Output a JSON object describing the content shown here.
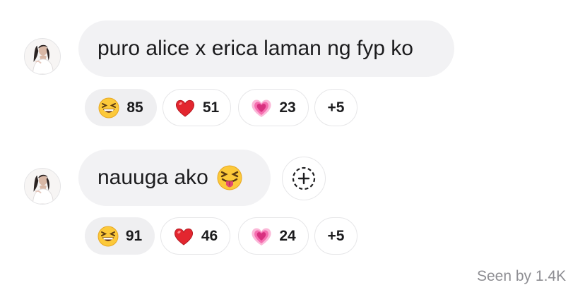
{
  "comments": [
    {
      "text": "puro alice x erica laman ng fyp ko",
      "reactions": [
        {
          "emoji": "grinning-squinting-face",
          "count": "85",
          "active": true
        },
        {
          "emoji": "red-heart",
          "count": "51"
        },
        {
          "emoji": "growing-heart",
          "count": "23"
        }
      ],
      "more": "+5"
    },
    {
      "text": "nauuga ako",
      "emoji": "squinting-face-with-tongue",
      "reactions": [
        {
          "emoji": "grinning-squinting-face",
          "count": "91",
          "active": true
        },
        {
          "emoji": "red-heart",
          "count": "46"
        },
        {
          "emoji": "growing-heart",
          "count": "24"
        }
      ],
      "more": "+5"
    }
  ],
  "footer": {
    "text": "Seen by 1.4K"
  },
  "colors": {
    "bubble": "#f2f2f4",
    "chip_active": "#efeff1",
    "border": "#e6e6e8",
    "muted": "#8e8e93"
  }
}
